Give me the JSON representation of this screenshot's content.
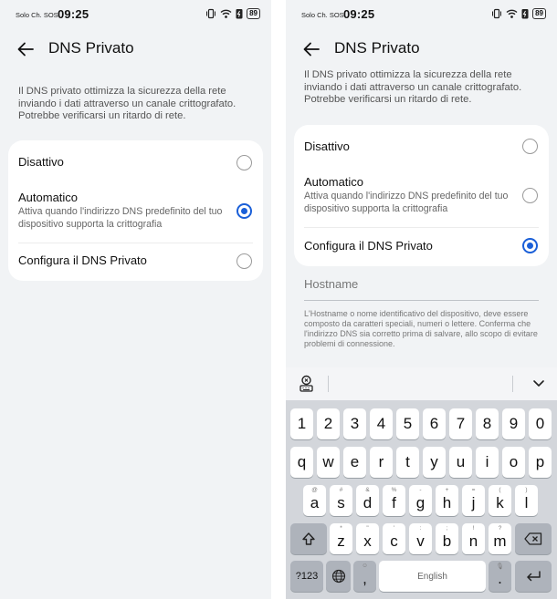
{
  "statusbar": {
    "carrier": "Solo Ch. SOS",
    "time": "09:25",
    "battery": "89",
    "icons": [
      "vibrate-icon",
      "wifi-icon",
      "battery-saver-icon",
      "battery-icon"
    ]
  },
  "page": {
    "title": "DNS Privato",
    "description": "Il DNS privato ottimizza la sicurezza della rete inviando i dati attraverso un canale crittografato. Potrebbe verificarsi un ritardo di rete."
  },
  "left_screen": {
    "options": [
      {
        "label": "Disattivo",
        "selected": false
      },
      {
        "label": "Automatico",
        "subtitle": "Attiva quando l'indirizzo DNS predefinito del tuo dispositivo supporta la crittografia",
        "selected": true
      },
      {
        "label": "Configura il DNS Privato",
        "selected": false
      }
    ]
  },
  "right_screen": {
    "options": [
      {
        "label": "Disattivo",
        "selected": false
      },
      {
        "label": "Automatico",
        "subtitle": "Attiva quando l'indirizzo DNS predefinito del tuo dispositivo supporta la crittografia",
        "selected": false
      },
      {
        "label": "Configura il DNS Privato",
        "selected": true
      }
    ],
    "hostname_placeholder": "Hostname",
    "hostname_help": "L'Hostname o nome identificativo del dispositivo, deve essere composto da caratteri speciali, numeri o lettere. Conferma che l'indirizzo DNS sia corretto prima di salvare, allo scopo di evitare problemi di connessione."
  },
  "keyboard": {
    "numbers": [
      "1",
      "2",
      "3",
      "4",
      "5",
      "6",
      "7",
      "8",
      "9",
      "0"
    ],
    "row1": [
      "q",
      "w",
      "e",
      "r",
      "t",
      "y",
      "u",
      "i",
      "o",
      "p"
    ],
    "row2": [
      {
        "key": "a",
        "hint": "@"
      },
      {
        "key": "s",
        "hint": "#"
      },
      {
        "key": "d",
        "hint": "&"
      },
      {
        "key": "f",
        "hint": "%"
      },
      {
        "key": "g",
        "hint": "-"
      },
      {
        "key": "h",
        "hint": "+"
      },
      {
        "key": "j",
        "hint": "="
      },
      {
        "key": "k",
        "hint": "("
      },
      {
        "key": "l",
        "hint": ")"
      }
    ],
    "row3": [
      {
        "key": "z",
        "hint": "*"
      },
      {
        "key": "x",
        "hint": "\""
      },
      {
        "key": "c",
        "hint": "'"
      },
      {
        "key": "v",
        "hint": ":"
      },
      {
        "key": "b",
        "hint": ";"
      },
      {
        "key": "n",
        "hint": "!"
      },
      {
        "key": "m",
        "hint": "?"
      }
    ],
    "symbols_key": "?123",
    "space_label": "English",
    "comma_hint": "☺",
    "period_hint": "🎙",
    "comma": ",",
    "period": "."
  },
  "colors": {
    "accent": "#1a5fd8",
    "screen_bg": "#f1f3f5",
    "card_bg": "#ffffff",
    "keyboard_bg": "#d3d6db"
  }
}
